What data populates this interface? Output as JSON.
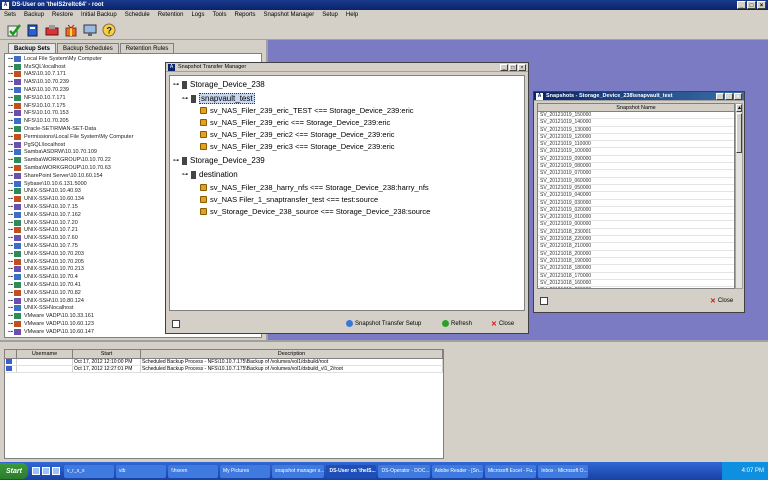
{
  "window_title": "DS-User on 'thelS2reltc64' - root",
  "menu": [
    "Sets",
    "Backup",
    "Restore",
    "Initial Backup",
    "Schedule",
    "Retention",
    "Logs",
    "Tools",
    "Reports",
    "Snapshot Manager",
    "Setup",
    "Help"
  ],
  "toolbar_icons": [
    "green-check-icon",
    "blue-book-icon",
    "red-tools-icon",
    "gift-icon",
    "monitor-icon",
    "help-icon"
  ],
  "left_tabs": [
    "Backup Sets",
    "Backup Schedules",
    "Retention Rules"
  ],
  "backup_sets": [
    "Local File System\\My Computer",
    "MsSQL\\localhost",
    "NAS\\10.10.7.171",
    "NAS\\10.10.70.239",
    "NAS\\10.10.70.239",
    "NFS\\10.10.7.171",
    "NFS\\10.10.7.175",
    "NFS\\10.10.70.153",
    "NFS\\10.10.70.205",
    "Oracle-SET\\RMAN-SET-Data",
    "Permissions\\Local File System\\My Computer",
    "PgSQL\\localhost",
    "Samba\\ASDRW\\10.10.70.109",
    "Samba\\WORKGROUP\\10.10.70.22",
    "Samba\\WORKGROUP\\10.10.70.63",
    "SharePoint Server\\10.10.60.154",
    "Sybase\\10.10.6.131.5000",
    "UNIX-SSH\\10.10.40.93",
    "UNIX-SSH\\10.10.60.134",
    "UNIX-SSH\\10.10.7.15",
    "UNIX-SSH\\10.10.7.162",
    "UNIX-SSH\\10.10.7.20",
    "UNIX-SSH\\10.10.7.21",
    "UNIX-SSH\\10.10.7.60",
    "UNIX-SSH\\10.10.7.75",
    "UNIX-SSH\\10.10.70.203",
    "UNIX-SSH\\10.10.70.205",
    "UNIX-SSH\\10.10.70.213",
    "UNIX-SSH\\10.10.70.4",
    "UNIX-SSH\\10.10.70.41",
    "UNIX-SSH\\10.10.70.82",
    "UNIX-SSH\\10.10.80.124",
    "UNIX-SSH\\localhost",
    "VMware VADP\\10.10.33.161",
    "VMware VADP\\10.10.60.123",
    "VMware VADP\\10.10.60.147",
    "VMware VADP\\10.10.60.180",
    "VMware VADP\\10.10.60.230",
    "VMware VADP\\10.10.60.66"
  ],
  "log_grid": {
    "headers": [
      "",
      "Username",
      "Start",
      "Description"
    ],
    "rows": [
      {
        "username": "",
        "start": "Oct 17, 2012 12:10:00 PM",
        "description": "Scheduled Backup Process - NFS\\10.10.7.175\\Backup of /volumes/vol1/dsbuild/root"
      },
      {
        "username": "",
        "start": "Oct 17, 2012 12:27:01 PM",
        "description": "Scheduled Backup Process - NFS\\10.10.7.175\\Backup of /volumes/vol1/dsbuild_vl1_2/root"
      }
    ]
  },
  "stm": {
    "title": "Snapshot Transfer Manager",
    "root1": "Storage_Device_238",
    "group1": "snapvault_test",
    "group1_items": [
      "sv_NAS_Filer_239_eric_TEST <== Storage_Device_239:eric",
      "sv_NAS_Filer_239_eric <== Storage_Device_239:eric",
      "sv_NAS_Filer_239_eric2 <== Storage_Device_239:eric",
      "sv_NAS_Filer_239_eric3 <== Storage_Device_239:eric"
    ],
    "root2": "Storage_Device_239",
    "group2": "destination",
    "group2_items": [
      "sv_NAS_Filer_238_harry_nfs <== Storage_Device_238:harry_nfs",
      "sv_NAS Filer_1_snaptransfer_test <== test:source",
      "sv_Storage_Device_238_source <== Storage_Device_238:source"
    ],
    "btn_setup": "Snapshot Transfer Setup",
    "btn_refresh": "Refresh",
    "btn_close": "Close"
  },
  "snapshots": {
    "title": "Snapshots - Storage_Device_238\\snapvault_test",
    "column": "Snapshot Name",
    "items": [
      "SV_20121019_150000",
      "SV_20121019_140000",
      "SV_20121019_130000",
      "SV_20121019_120000",
      "SV_20121019_110000",
      "SV_20121019_100000",
      "SV_20121019_090000",
      "SV_20121019_080000",
      "SV_20121019_070000",
      "SV_20121019_060000",
      "SV_20121019_050000",
      "SV_20121019_040000",
      "SV_20121019_030000",
      "SV_20121019_020000",
      "SV_20121019_010000",
      "SV_20121019_000000",
      "SV_20121018_230001",
      "SV_20121018_220000",
      "SV_20121018_210000",
      "SV_20121018_200000",
      "SV_20121018_190000",
      "SV_20121018_180000",
      "SV_20121018_170000",
      "SV_20121018_160000",
      "SV_20121018_090000"
    ],
    "btn_close": "Close"
  },
  "taskbar": {
    "start": "Start",
    "tasks": [
      "v_r_s_s",
      "vib",
      "\\\\hxeen",
      "My Pictures",
      "snapshot manager s...",
      "DS-User on 'thelS...",
      "DS-Operator - DOC...",
      "Adobe Reader - [Sn...",
      "Microsoft Excel - Fu...",
      "Inbox - Microsoft O..."
    ],
    "clock": "4:07 PM"
  }
}
